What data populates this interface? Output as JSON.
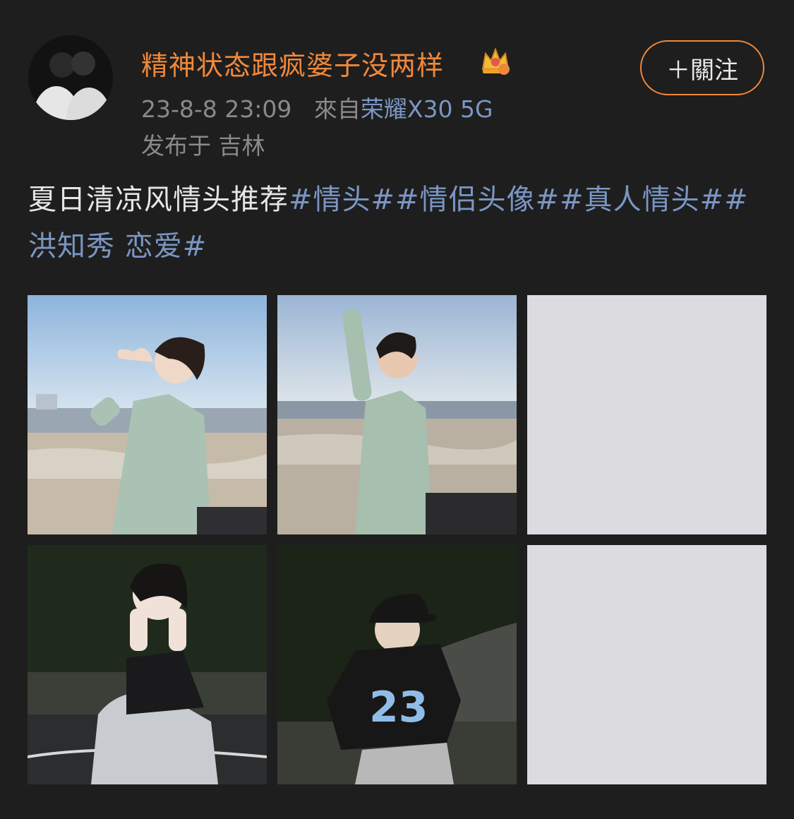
{
  "post": {
    "author": {
      "name": "精神状态跟疯婆子没两样",
      "crown_badge": "crown-icon"
    },
    "timestamp": "23-8-8 23:09",
    "source_prefix": "來自",
    "device": "荣耀X30 5G",
    "location": "发布于 吉林",
    "follow_button": "＋關注",
    "text": "夏日清凉风情头推荐",
    "hashtags": [
      "#情头#",
      "#情侣头像#",
      "#真人情头#",
      "#洪知秀 恋爱#"
    ],
    "images": [
      {
        "name": "photo-girl-heart-hands-beach",
        "loaded": true
      },
      {
        "name": "photo-boy-hand-on-head-beach",
        "loaded": true
      },
      {
        "name": "image-placeholder",
        "loaded": false
      },
      {
        "name": "photo-girl-crouching-night",
        "loaded": true
      },
      {
        "name": "photo-boy-cap-jersey-night",
        "loaded": true
      },
      {
        "name": "image-placeholder",
        "loaded": false
      }
    ]
  },
  "colors": {
    "background": "#1e1e1e",
    "username": "#f0883a",
    "hashtag": "#7b96c4",
    "meta": "#8a8a8a",
    "placeholder": "#dcdce0"
  }
}
